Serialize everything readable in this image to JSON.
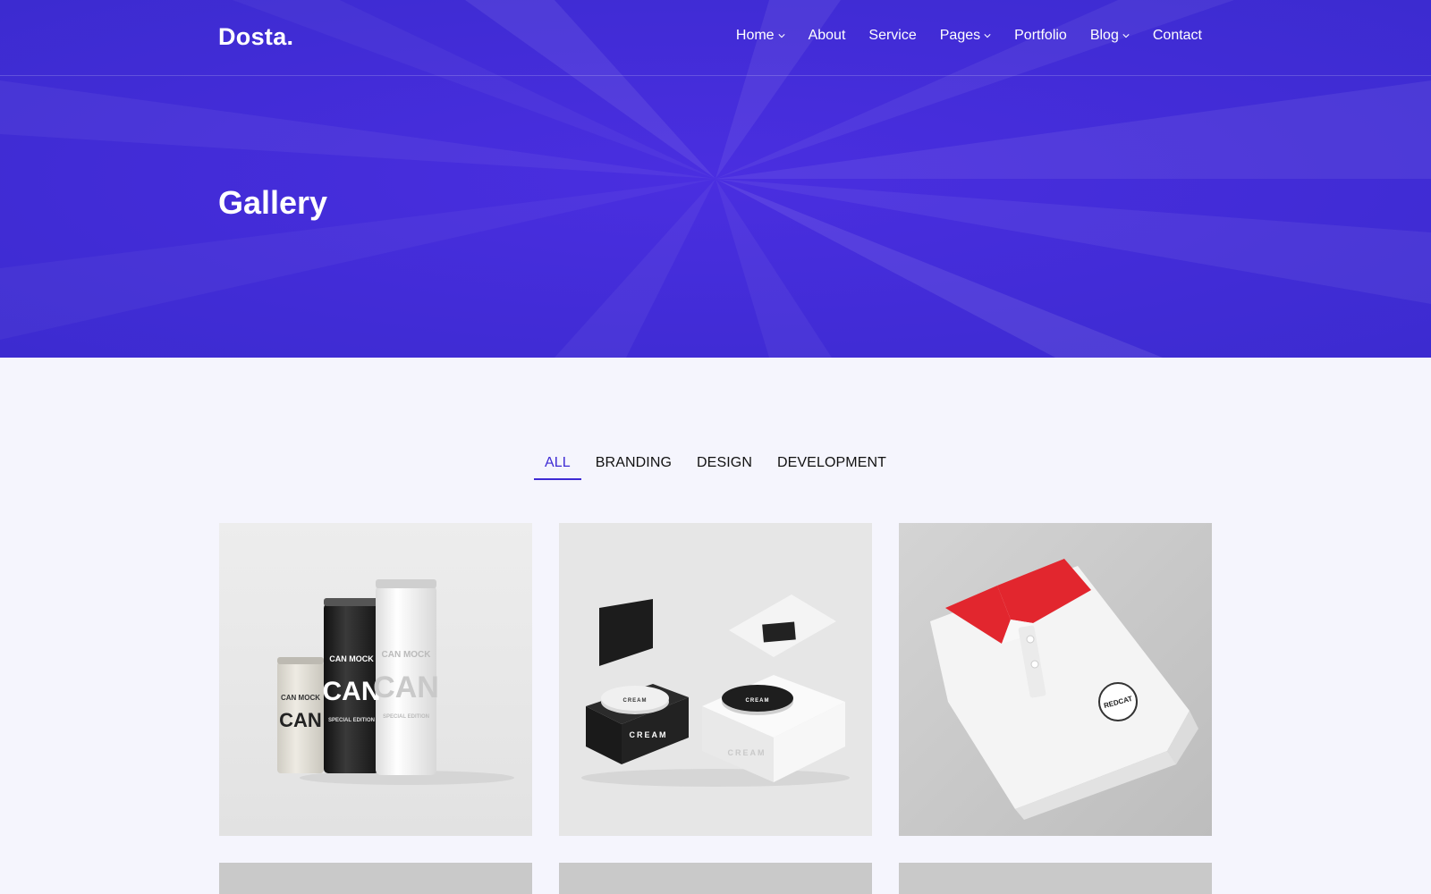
{
  "brand": {
    "logo": "Dosta."
  },
  "nav": {
    "items": [
      {
        "label": "Home",
        "dropdown": true
      },
      {
        "label": "About",
        "dropdown": false
      },
      {
        "label": "Service",
        "dropdown": false
      },
      {
        "label": "Pages",
        "dropdown": true
      },
      {
        "label": "Portfolio",
        "dropdown": false
      },
      {
        "label": "Blog",
        "dropdown": true
      },
      {
        "label": "Contact",
        "dropdown": false
      }
    ]
  },
  "hero": {
    "title": "Gallery"
  },
  "filters": {
    "items": [
      "ALL",
      "BRANDING",
      "DESIGN",
      "DEVELOPMENT"
    ],
    "active": "ALL"
  },
  "gallery": {
    "cards": [
      {
        "subject": "cans",
        "text": {
          "small": "CAN MOCK",
          "big": "CAN",
          "edition": "SPECIAL EDITION"
        }
      },
      {
        "subject": "cream-boxes",
        "text": {
          "label": "CREAM"
        }
      },
      {
        "subject": "polo-shirt",
        "text": {
          "badge": "REDCAT"
        }
      }
    ]
  },
  "colors": {
    "accent": "#3e2bd4",
    "background": "#f5f5fd",
    "collar": "#e2262e"
  }
}
